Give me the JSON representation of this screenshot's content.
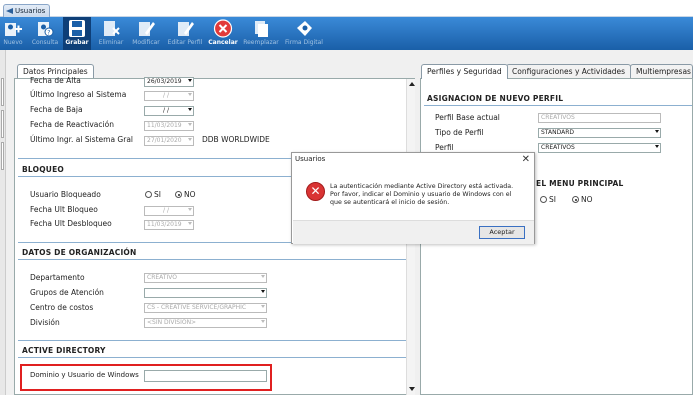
{
  "window_tab": {
    "label": "Usuarios"
  },
  "toolbar": {
    "buttons": [
      {
        "label": "Nuevo",
        "icon": "new-user-icon"
      },
      {
        "label": "Consulta",
        "icon": "query-user-icon"
      },
      {
        "label": "Grabar",
        "icon": "save-icon"
      },
      {
        "label": "Eliminar",
        "icon": "delete-icon"
      },
      {
        "label": "Modificar",
        "icon": "edit-icon"
      },
      {
        "label": "Editar Perfil",
        "icon": "edit-profile-icon"
      },
      {
        "label": "Cancelar",
        "icon": "cancel-icon"
      },
      {
        "label": "Reemplazar",
        "icon": "replace-icon"
      },
      {
        "label": "Firma Digital",
        "icon": "digital-signature-icon"
      }
    ]
  },
  "left_tab": {
    "label": "Datos Principales"
  },
  "principal": {
    "fecha_alta": {
      "label": "Fecha de Alta",
      "value": "26/03/2019"
    },
    "ultimo_ingreso": {
      "label": "Último Ingreso al Sistema",
      "value": "/ /"
    },
    "fecha_baja": {
      "label": "Fecha de Baja",
      "value": "/ /"
    },
    "fecha_reactivacion": {
      "label": "Fecha de Reactivación",
      "value": "11/03/2019"
    },
    "ultimo_ingr_gral": {
      "label": "Último Ingr. al Sistema Gral",
      "value": "27/01/2020",
      "extra": "DDB WORLDWIDE"
    }
  },
  "bloqueo": {
    "title": "BLOQUEO",
    "usuario_bloqueado": {
      "label": "Usuario Bloqueado",
      "si": "SI",
      "no": "NO"
    },
    "fecha_ult_bloqueo": {
      "label": "Fecha Ult Bloqueo",
      "value": "/ /"
    },
    "fecha_ult_desbloqueo": {
      "label": "Fecha Ult Desbloqueo",
      "value": "11/03/2019"
    }
  },
  "organizacion": {
    "title": "DATOS DE ORGANIZACIÓN",
    "departamento": {
      "label": "Departamento",
      "value": "CREATIVO"
    },
    "grupos": {
      "label": "Grupos de Atención",
      "value": ""
    },
    "centro": {
      "label": "Centro de costos",
      "value": "CS - CREATIVE SERVICE/GRAPHIC"
    },
    "division": {
      "label": "División",
      "value": "<SIN DIVISION>"
    }
  },
  "active_directory": {
    "title": "ACTIVE DIRECTORY",
    "dominio": {
      "label": "Dominio y Usuario de Windows",
      "value": ""
    }
  },
  "right_tabs": [
    "Perfiles y Seguridad",
    "Configuraciones y Actividades",
    "Multiempresas"
  ],
  "perfil": {
    "title": "ASIGNACION DE NUEVO PERFIL",
    "base": {
      "label": "Perfil Base actual",
      "value": "CREATIVOS"
    },
    "tipo": {
      "label": "Tipo de Perfil",
      "value": "STANDARD"
    },
    "perfil": {
      "label": "Perfil",
      "value": "CREATIVOS"
    },
    "menu_title_fragment": "EL MENU PRINCIPAL",
    "si": "SI",
    "no": "NO"
  },
  "dialog": {
    "title": "Usuarios",
    "message": "La autenticación mediante Active Directory está activada. Por favor, indicar el Dominio y usuario de Windows con el que se autenticará el inicio de sesión.",
    "ok": "Aceptar"
  },
  "colors": {
    "toolbar": "#1f6bb8",
    "highlight": "#e02020",
    "section_rule": "#8cb0d0"
  }
}
